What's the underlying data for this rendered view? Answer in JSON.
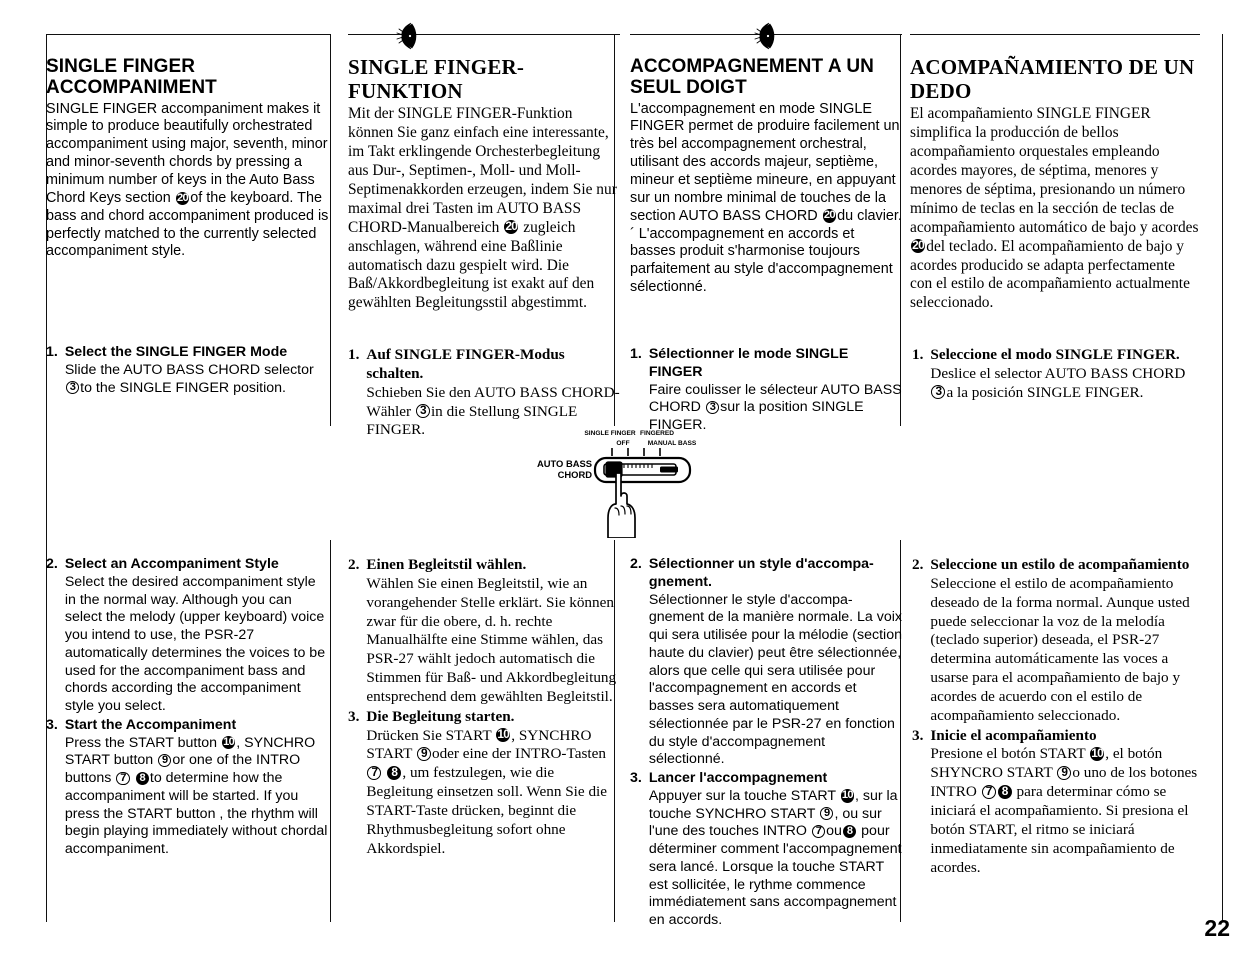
{
  "page": {
    "number": "22"
  },
  "columns": {
    "english": {
      "title": "SINGLE FINGER ACCOMPANIMENT",
      "intro_a": "SINGLE FINGER accompaniment makes it simple to produce beautifully orchestrated accompaniment using major, seventh, minor and minor-seventh chords by pressing a minimum number of keys in the Auto Bass Chord Keys section ",
      "intro_ref": "20",
      "intro_b": "of the keyboard. The bass and chord accompaniment produced is perfectly matched to the currently selected accompaniment style.",
      "step1": {
        "num": "1.",
        "head": "Select the SINGLE FINGER Mode",
        "text_a": "Slide the AUTO BASS CHORD selector ",
        "ref": "3",
        "text_b": "to the SINGLE FINGER position."
      },
      "step2": {
        "num": "2.",
        "head": "Select an Accompaniment Style",
        "text": "Select the desired accompaniment style in the normal way. Although you can select the melody (upper keyboard) voice you intend to use, the PSR-27 automatically determines the voices to be used for the accompaniment bass and chords according the accompaniment style you select."
      },
      "step3": {
        "num": "3.",
        "head": "Start the Accompaniment",
        "text_a": "Press the START button ",
        "ref1": "10",
        "text_b": ", SYNCHRO START button ",
        "ref2": "9",
        "text_c": "or one of the INTRO buttons ",
        "ref3": "7",
        "ref4": "8",
        "text_d": "to determine how the accompaniment will be started. If you press the START button , the rhythm will begin playing immediately without chordal accompaniment."
      }
    },
    "german": {
      "title": "SINGLE FINGER-FUNKTION",
      "intro_a": "Mit der SINGLE FINGER-Funktion können Sie ganz einfach eine interessante, im Takt erklingende Orchesterbegleitung aus Dur-, Septimen-, Moll- und Moll-Septimenakkorden erzeugen, indem Sie nur maximal drei Tasten im AUTO BASS CHORD-Manualbereich ",
      "intro_ref": "20",
      "intro_b": "zugleich anschlagen, während eine Baßlinie automatisch dazu gespielt wird. Die Baß/Akkordbegleitung ist exakt auf den gewählten Begleitungsstil abgestimmt.",
      "step1": {
        "num": "1.",
        "head": "Auf SINGLE FINGER-Modus schalten.",
        "text_a": "Schieben Sie den AUTO BASS CHORD-Wähler ",
        "ref": "3",
        "text_b": "in die Stellung SINGLE FINGER."
      },
      "step2": {
        "num": "2.",
        "head": "Einen Begleitstil wählen.",
        "text": "Wählen Sie einen Begleitstil, wie an vorangehender Stelle erklärt. Sie können zwar für die obere, d. h. rechte  Manualhälfte eine Stimme wählen, das PSR-27 wählt jedoch automatisch die Stimmen für Baß- und Akkordbegleitung entsprechend dem gewählten Begleitstil."
      },
      "step3": {
        "num": "3.",
        "head": "Die Begleitung starten.",
        "text_a": "Drücken Sie START ",
        "ref1": "10",
        "text_b": ", SYNCHRO START ",
        "ref2": "9",
        "text_c": "oder eine der INTRO-Tasten ",
        "ref3": "7",
        "ref4": "8",
        "text_d": ", um festzulegen, wie die Begleitung einsetzen soll. Wenn Sie die START-Taste drücken, beginnt die Rhythmusbegleitung sofort ohne Akkordspiel."
      }
    },
    "french": {
      "title": "ACCOMPAGNEMENT A UN SEUL DOIGT",
      "intro_a": "L'accompagnement en mode SINGLE FINGER permet de produire facilement un très bel accompagnement orchestral, utilisant des accords majeur, septième, mineur et septième mineure, en appuyant sur un nombre minimal de touches de la section AUTO BASS CHORD ",
      "intro_ref": "20",
      "intro_b": "du clavier.´ L'accompagnement en accords et basses produit s'harmonise toujours parfaitement au style d'accompagnement sélectionné.",
      "step1": {
        "num": "1.",
        "head": "Sélectionner le mode SINGLE FINGER",
        "text_a": "Faire coulisser le sélecteur AUTO BASS CHORD ",
        "ref": "3",
        "text_b": "sur la position SINGLE FINGER."
      },
      "step2": {
        "num": "2.",
        "head": "Sélectionner un style d'accompa-gnement.",
        "text": "Sélectionner le style d'accompa-gnement de la manière normale.  La voix qui sera utilisée pour la mélodie (section haute du clavier) peut être sélectionnée, alors que celle qui sera utilisée pour l'accompagnement en accords et basses sera automatiquement sélectionnée par le PSR-27 en fonction du style d'accompagnement sélectionné."
      },
      "step3": {
        "num": "3.",
        "head": "Lancer l'accompagnement",
        "text_a": "Appuyer sur la touche START ",
        "ref1": "10",
        "text_b": ", sur la touche SYNCHRO START ",
        "ref2": "9",
        "text_c": ", ou sur l'une des touches INTRO ",
        "ref3": "7",
        "text_mid": "ou",
        "ref4": "8",
        "text_d": "pour déterminer comment l'accompagnement sera lancé. Lorsque la touche START est sollicitée, le rythme commence immédiatement sans accompagnement en accords."
      }
    },
    "spanish": {
      "title": "ACOMPAÑAMIENTO DE UN DEDO",
      "intro_a": "El acompañamiento SINGLE FINGER simplifica la producción de bellos acompañamiento orquestales empleando acordes mayores, de séptima, menores y menores de séptima, presionando un número mínimo de teclas en la sección de teclas de acompañamiento automático de bajo y acordes ",
      "intro_ref": "20",
      "intro_b": "del teclado.  El acompañamiento de bajo y acordes producido se adapta perfectamente con el estilo de acompañamiento actualmente seleccionado.",
      "step1": {
        "num": "1.",
        "head": "Seleccione el modo SINGLE FINGER.",
        "text_a": "Deslice el selector AUTO BASS CHORD ",
        "ref": "3",
        "text_b": "a la posición SINGLE FINGER."
      },
      "step2": {
        "num": "2.",
        "head": "Seleccione un estilo de acompañamiento",
        "text": "Seleccione el estilo de acompañamiento deseado de la forma normal.  Aunque usted puede seleccionar la voz de la melodía (teclado superior) deseada, el PSR-27 determina automáticamente las voces a usarse para el acompañamiento de bajo y acordes de acuerdo con el estilo de acompañamiento seleccionado."
      },
      "step3": {
        "num": "3.",
        "head": "Inicie el acompañamiento",
        "text_a": "Presione el botón START ",
        "ref1": "10",
        "text_b": ", el botón SHYNCRO START ",
        "ref2": "9",
        "text_c": "o uno de los botones INTRO ",
        "ref3": "7",
        "ref4": "8",
        "text_d": "para determinar cómo se iniciará el acompañamiento.  Si presiona el botón START, el ritmo se iniciará inmediatamente sin acompañamiento de acordes."
      }
    }
  },
  "illustration": {
    "label_left_line1": "AUTO BASS",
    "label_left_line2": "CHORD",
    "label_single_finger": "SINGLE FINGER",
    "label_off": "OFF",
    "label_fingered": "FINGERED",
    "label_manual_bass": "MANUAL BASS"
  },
  "colors": {
    "ink": "#000000",
    "paper": "#ffffff"
  }
}
